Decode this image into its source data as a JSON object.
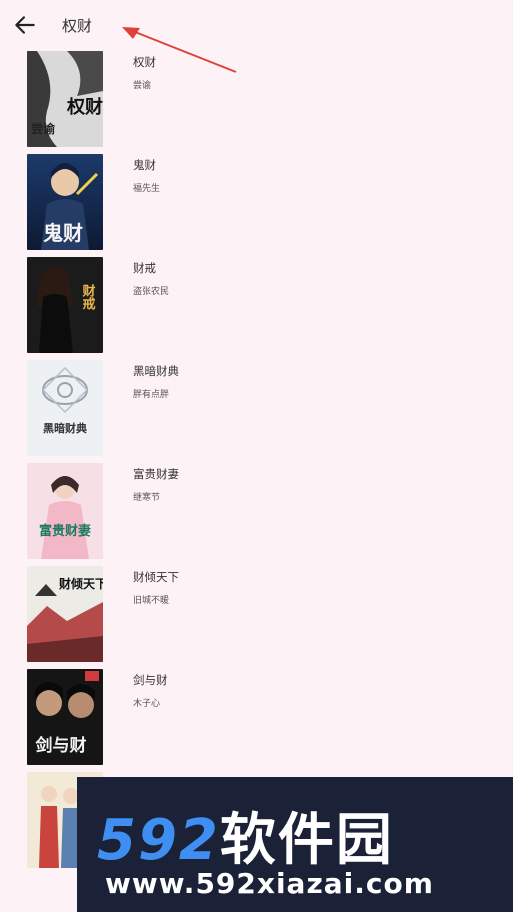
{
  "header": {
    "title": "权财"
  },
  "books": [
    {
      "title": "权财",
      "author": "尝谕",
      "cover_text": "权财",
      "cover_sub": "尝谕"
    },
    {
      "title": "鬼财",
      "author": "福先生",
      "cover_text": "鬼财"
    },
    {
      "title": "财戒",
      "author": "盗张农民",
      "cover_text": "财戒"
    },
    {
      "title": "黑暗财典",
      "author": "胖有点胖",
      "cover_text": "黑暗财典"
    },
    {
      "title": "富贵财妻",
      "author": "继寒节",
      "cover_text": "富贵财妻"
    },
    {
      "title": "财倾天下",
      "author": "旧城不暖",
      "cover_text": "财倾天下"
    },
    {
      "title": "剑与财",
      "author": "木子心",
      "cover_text": "剑与财"
    },
    {
      "title": "",
      "author": ""
    }
  ],
  "watermark": {
    "brand_num": "592",
    "brand_cn": "软件园",
    "url": "www.592xiazai.com"
  },
  "colors": {
    "background": "#fdf3f6",
    "arrow": "#e0403a"
  }
}
